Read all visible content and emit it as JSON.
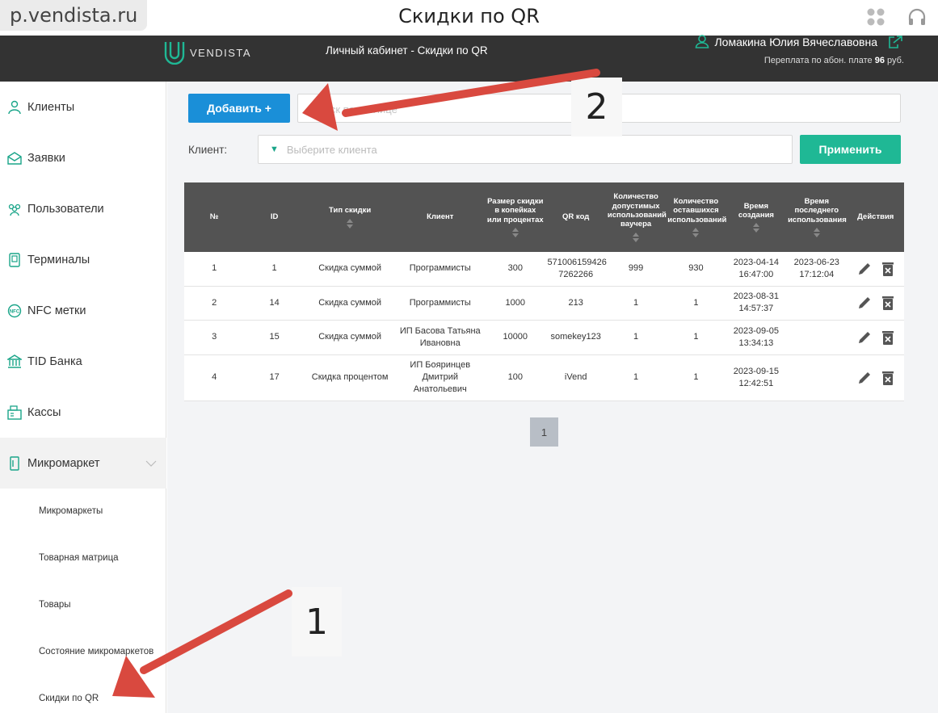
{
  "titlebar": {
    "url": "p.vendista.ru",
    "title": "Скидки по QR",
    "icons": [
      "apps-icon",
      "headphones-icon"
    ]
  },
  "header": {
    "logo_text": "VENDISTA",
    "subtitle": "Личный кабинет - Скидки по QR",
    "user_name": "Ломакина Юлия Вячеславовна",
    "balance_prefix": "Переплата по абон. плате",
    "balance_value": "96",
    "balance_suffix": "руб."
  },
  "sidebar": {
    "items": [
      {
        "label": "Клиенты",
        "icon": "clients-icon"
      },
      {
        "label": "Заявки",
        "icon": "requests-icon"
      },
      {
        "label": "Пользователи",
        "icon": "users-icon"
      },
      {
        "label": "Терминалы",
        "icon": "terminal-icon"
      },
      {
        "label": "NFC метки",
        "icon": "nfc-icon"
      },
      {
        "label": "TID Банка",
        "icon": "bank-icon"
      },
      {
        "label": "Кассы",
        "icon": "cashier-icon"
      },
      {
        "label": "Микромаркет",
        "icon": "micromarket-icon"
      }
    ],
    "subitems": [
      {
        "label": "Микромаркеты"
      },
      {
        "label": "Товарная матрица"
      },
      {
        "label": "Товары"
      },
      {
        "label": "Состояние микромаркетов"
      },
      {
        "label": "Скидки по QR"
      }
    ]
  },
  "toolbar": {
    "add_label": "Добавить +",
    "search_placeholder": "Поиск по таблице",
    "client_label": "Клиент:",
    "client_placeholder": "Выберите клиента",
    "apply_label": "Применить"
  },
  "table": {
    "headers": [
      "№",
      "ID",
      "Тип скидки",
      "Клиент",
      "Размер скидки в копейках или процентах",
      "QR код",
      "Количество допустимых использований ваучера",
      "Количество оставшихся использований",
      "Время создания",
      "Время последнего использования",
      "Действия"
    ],
    "rows": [
      [
        "1",
        "1",
        "Скидка суммой",
        "Программисты",
        "300",
        "571006159426 7262266",
        "999",
        "930",
        "2023-04-14 16:47:00",
        "2023-06-23 17:12:04"
      ],
      [
        "2",
        "14",
        "Скидка суммой",
        "Программисты",
        "1000",
        "213",
        "1",
        "1",
        "2023-08-31 14:57:37",
        ""
      ],
      [
        "3",
        "15",
        "Скидка суммой",
        "ИП Басова Татьяна Ивановна",
        "10000",
        "somekey123",
        "1",
        "1",
        "2023-09-05 13:34:13",
        ""
      ],
      [
        "4",
        "17",
        "Скидка процентом",
        "ИП Бояринцев Дмитрий Анатольевич",
        "100",
        "iVend",
        "1",
        "1",
        "2023-09-15 12:42:51",
        ""
      ]
    ]
  },
  "pagination": {
    "current": "1"
  },
  "annotations": {
    "label_1": "1",
    "label_2": "2"
  },
  "colors": {
    "accent_blue": "#1a8fd8",
    "accent_green": "#1fb895",
    "header_dark": "#333333",
    "annotation_arrow": "#d9493f"
  }
}
